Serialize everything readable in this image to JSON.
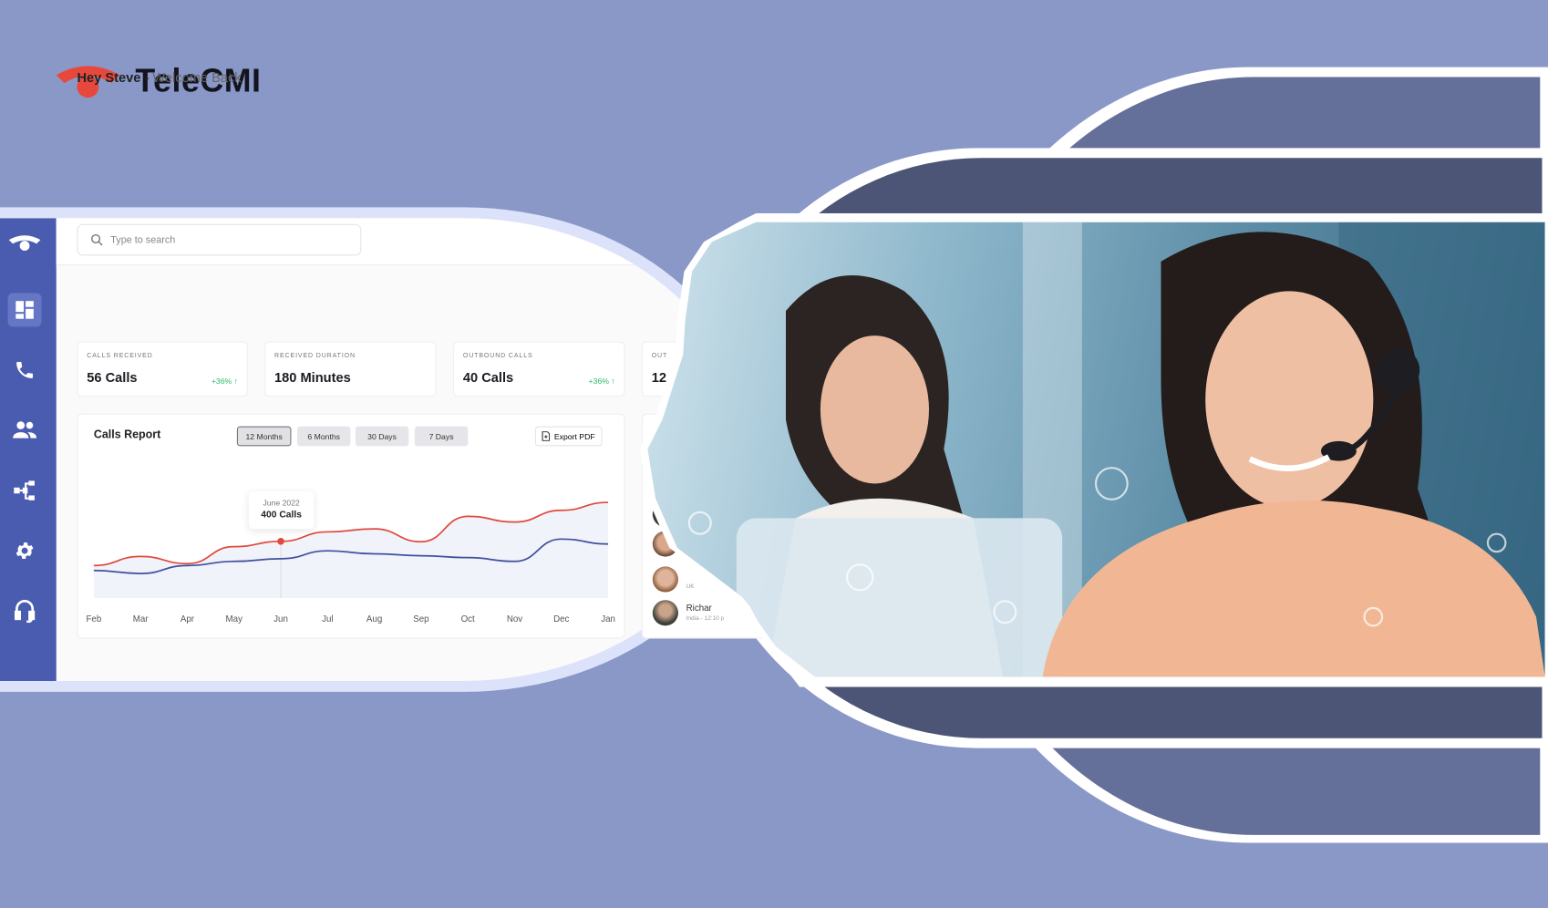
{
  "brand": {
    "name": "TeleCMI",
    "logo_color": "#e8483b"
  },
  "sidebar": {
    "items": [
      {
        "icon": "telecmi-logo-icon"
      },
      {
        "icon": "dashboard-icon",
        "active": true
      },
      {
        "icon": "phone-icon"
      },
      {
        "icon": "users-icon"
      },
      {
        "icon": "flow-icon"
      },
      {
        "icon": "gear-icon"
      },
      {
        "icon": "headset-icon"
      }
    ],
    "color": "#4a5cb0"
  },
  "search": {
    "placeholder": "Type to search"
  },
  "greeting": {
    "name": "Hey Steve -",
    "message": "Welcome Back"
  },
  "stats": [
    {
      "label": "CALLS RECEIVED",
      "value": "56 Calls",
      "change": "+36% ↑"
    },
    {
      "label": "RECEIVED DURATION",
      "value": "180 Minutes",
      "change": ""
    },
    {
      "label": "OUTBOUND CALLS",
      "value": "40 Calls",
      "change": "+36% ↑"
    },
    {
      "label": "OUT",
      "value": "12",
      "change": ""
    }
  ],
  "report": {
    "title": "Calls Report",
    "tabs": [
      "12 Months",
      "6 Months",
      "30 Days",
      "7 Days"
    ],
    "selected_tab": "12 Months",
    "export_label": "Export PDF",
    "tooltip": {
      "date": "June 2022",
      "value": "400 Calls"
    }
  },
  "chart_data": {
    "type": "line",
    "categories": [
      "Feb",
      "Mar",
      "Apr",
      "May",
      "Jun",
      "Jul",
      "Aug",
      "Sep",
      "Oct",
      "Nov",
      "Dec",
      "Jan"
    ],
    "series": [
      {
        "color": "#e0493d",
        "values": [
          336,
          360,
          341,
          386,
          400,
          425,
          433,
          399,
          466,
          451,
          482,
          503
        ]
      },
      {
        "color": "#3f519e",
        "values": [
          323,
          315,
          336,
          347,
          354,
          375,
          367,
          362,
          357,
          347,
          406,
          393
        ]
      }
    ],
    "ylim": [
      250,
      550
    ],
    "grid": false,
    "highlight": {
      "category": "Jun",
      "value": 400
    }
  },
  "contacts": [
    {
      "name": "",
      "meta": "UK"
    },
    {
      "name": "Richar",
      "meta": "India - 12:10 p"
    }
  ]
}
